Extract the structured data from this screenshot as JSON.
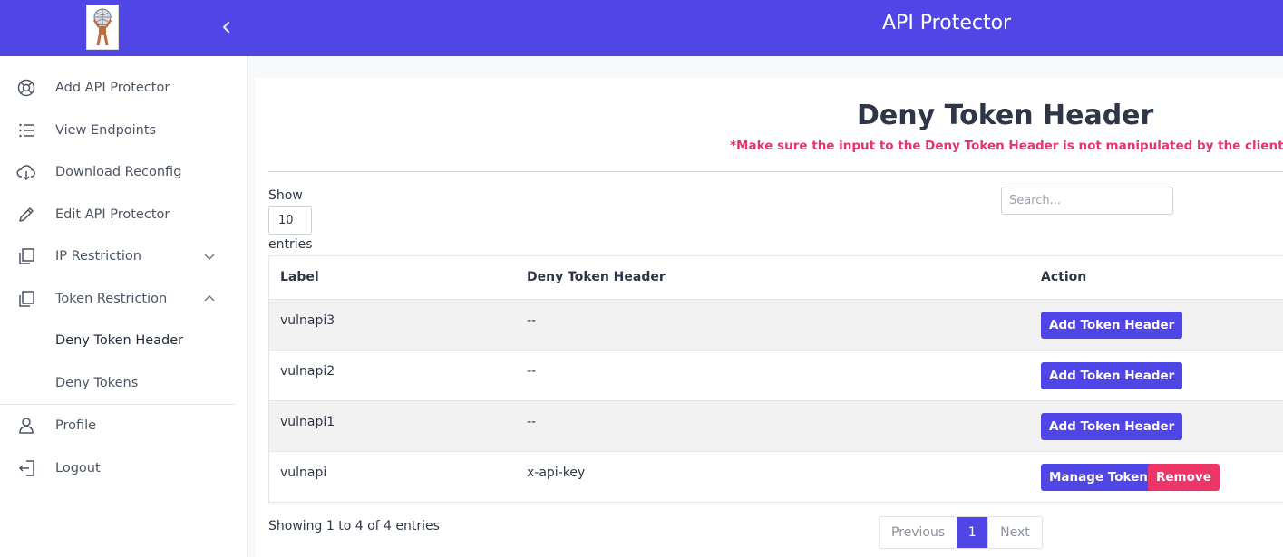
{
  "app": {
    "title": "API Protector"
  },
  "sidebar": {
    "items": [
      {
        "label": "Add API Protector",
        "icon": "lifebuoy-icon"
      },
      {
        "label": "View Endpoints",
        "icon": "list-icon"
      },
      {
        "label": "Download Reconfig",
        "icon": "cloud-download-icon"
      },
      {
        "label": "Edit API Protector",
        "icon": "pencil-icon"
      },
      {
        "label": "IP Restriction",
        "icon": "copy-icon",
        "expanded": false
      },
      {
        "label": "Token Restriction",
        "icon": "copy-icon",
        "expanded": true
      }
    ],
    "sub_items": [
      {
        "label": "Deny Token Header",
        "active": true
      },
      {
        "label": "Deny Tokens",
        "active": false
      }
    ],
    "bottom_items": [
      {
        "label": "Profile",
        "icon": "user-icon"
      },
      {
        "label": "Logout",
        "icon": "logout-icon"
      }
    ]
  },
  "main": {
    "title": "Deny Token Header",
    "warning": "*Make sure the input to the Deny Token Header is not manipulated by the client.",
    "length_menu": {
      "show_label": "Show",
      "value": "10",
      "entries_label": "entries"
    },
    "search": {
      "placeholder": "Search...",
      "value": ""
    },
    "table": {
      "columns": [
        "Label",
        "Deny Token Header",
        "Action"
      ],
      "rows": [
        {
          "label": "vulnapi3",
          "header": "--",
          "actions": [
            "Add Token Header"
          ]
        },
        {
          "label": "vulnapi2",
          "header": "--",
          "actions": [
            "Add Token Header"
          ]
        },
        {
          "label": "vulnapi1",
          "header": "--",
          "actions": [
            "Add Token Header"
          ]
        },
        {
          "label": "vulnapi",
          "header": "x-api-key",
          "actions": [
            "Manage Token",
            "Remove"
          ]
        }
      ]
    },
    "info": "Showing 1 to 4 of 4 entries",
    "pagination": {
      "previous": "Previous",
      "page": "1",
      "next": "Next"
    }
  },
  "colors": {
    "brand": "#5046e5",
    "danger": "#ec3668",
    "warning_text": "#e4356d"
  }
}
